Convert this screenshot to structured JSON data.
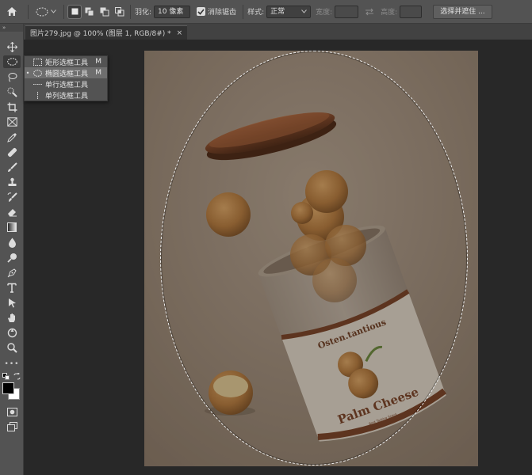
{
  "options_bar": {
    "feather_label": "羽化:",
    "feather_value": "10 像素",
    "antialias_label": "消除锯齿",
    "antialias_checked": true,
    "style_label": "样式:",
    "style_value": "正常",
    "width_label": "宽度:",
    "height_label": "高度:",
    "select_mask_button": "选择并遮住 ..."
  },
  "tab": {
    "title": "图片279.jpg @ 100% (图层 1, RGB/8#) *",
    "close": "×"
  },
  "toolbar": {
    "collapse_glyph": "»",
    "tools": [
      "move-tool",
      "elliptical-marquee-tool",
      "lasso-tool",
      "quick-selection-tool",
      "crop-tool",
      "frame-tool",
      "eyedropper-tool",
      "healing-brush-tool",
      "brush-tool",
      "clone-stamp-tool",
      "history-brush-tool",
      "eraser-tool",
      "gradient-tool",
      "blur-tool",
      "dodge-tool",
      "pen-tool",
      "type-tool",
      "path-selection-tool",
      "rectangle-tool",
      "3d-tool",
      "zoom-tool",
      "more-tools"
    ],
    "more": "•••",
    "active_tool": "elliptical-marquee-tool",
    "foreground_color": "#000000",
    "background_color": "#ffffff"
  },
  "flyout": {
    "items": [
      {
        "label": "矩形选框工具",
        "shortcut": "M",
        "selected": false,
        "icon": "rect-marquee-icon"
      },
      {
        "label": "椭圆选框工具",
        "shortcut": "M",
        "selected": true,
        "icon": "ellipse-marquee-icon"
      },
      {
        "label": "单行选框工具",
        "shortcut": "",
        "selected": false,
        "icon": "single-row-marquee-icon"
      },
      {
        "label": "单列选框工具",
        "shortcut": "",
        "selected": false,
        "icon": "single-column-marquee-icon"
      }
    ],
    "bullet": "•"
  },
  "image": {
    "label_top": "Osten.tantious",
    "label_main": "Palm Cheese",
    "label_small": "Best Tasting Snack",
    "background_color": "#9c8a78",
    "jar_lid_color": "#7a3f22"
  }
}
